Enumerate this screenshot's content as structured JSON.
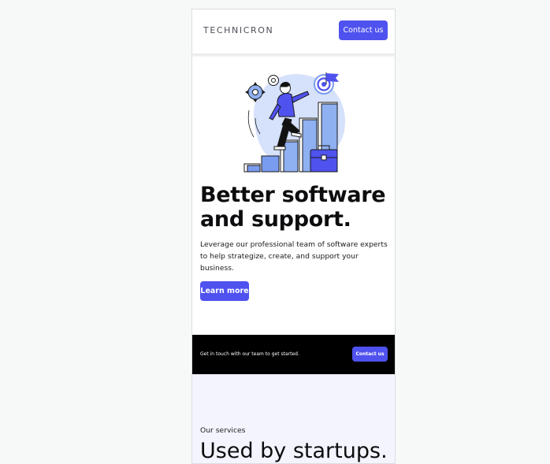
{
  "header": {
    "logo_text": "TECHNICRON",
    "contact_label": "Contact us"
  },
  "hero": {
    "illustration_icon": "person-climbing-bar-chart-illustration",
    "headline": "Better software and support.",
    "description": "Leverage our professional team of software experts to help strategize, create, and support your business.",
    "button_label": "Learn more"
  },
  "cta": {
    "text": "Get in touch with our team to get started.",
    "button_label": "Contact us"
  },
  "services": {
    "label": "Our services",
    "title": "Used by startups."
  },
  "colors": {
    "accent": "#4f52ee",
    "illustration_blue": "#a8c0f5",
    "cta_background": "#000000",
    "services_background": "#f3f4fd"
  }
}
